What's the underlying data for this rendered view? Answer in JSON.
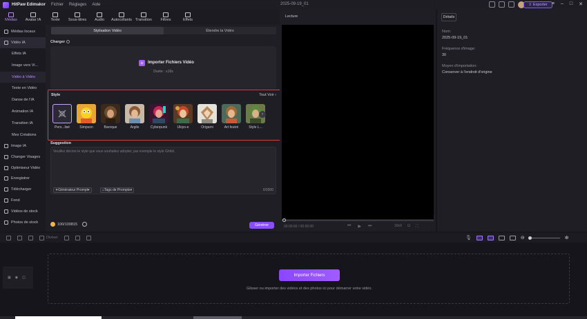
{
  "app": {
    "name": "HitPaw Edimakor",
    "menus": [
      "Fichier",
      "Réglages",
      "Aide"
    ],
    "project_date": "2025-09-19_01",
    "export_label": "Exporter"
  },
  "top_tabs": [
    "Médias",
    "Avatar IA",
    "Texte",
    "Sous-titres",
    "Audio",
    "Autocollants",
    "Transition",
    "Filtres",
    "Effets"
  ],
  "sidebar": {
    "items": [
      {
        "label": "Médias locaux",
        "level": "main"
      },
      {
        "label": "Vidéo IA",
        "level": "main",
        "active": true
      },
      {
        "label": "Effets IA",
        "level": "sub"
      },
      {
        "label": "Image vers Vi...",
        "level": "sub"
      },
      {
        "label": "Vidéo à Vidéo",
        "level": "sub",
        "selected": true
      },
      {
        "label": "Texte en Vidéo",
        "level": "sub"
      },
      {
        "label": "Danse de l'IA",
        "level": "sub"
      },
      {
        "label": "Animation IA",
        "level": "sub"
      },
      {
        "label": "Transition IA",
        "level": "sub"
      },
      {
        "label": "Mes Créations",
        "level": "sub"
      },
      {
        "label": "Image IA",
        "level": "main"
      },
      {
        "label": "Changer Visages",
        "level": "main"
      },
      {
        "label": "Optimiseur Vidéo",
        "level": "main"
      },
      {
        "label": "Enregistrer",
        "level": "main"
      },
      {
        "label": "Télécharger",
        "level": "main"
      },
      {
        "label": "Fond",
        "level": "main"
      },
      {
        "label": "Vidéos de stock",
        "level": "main"
      },
      {
        "label": "Photos de stock",
        "level": "main"
      }
    ]
  },
  "main": {
    "segments": [
      "Stylisation Vidéo",
      "Étendre la Vidéo"
    ],
    "charger_label": "Charger",
    "upload_title": "Importer Fichiers Vidéo",
    "upload_sub": "Durée : ≤16s",
    "style_label": "Style",
    "see_all": "Tout Voir",
    "styles": [
      "Pers...lisé",
      "Simpson",
      "Baroque",
      "Argile",
      "Cyberpunk",
      "Ukiyo-e",
      "Origami",
      "Art feutré",
      "Style L..."
    ],
    "suggestion_label": "Suggestion",
    "suggestion_placeholder": "Veuillez décrire le style que vous souhaitez adopter, par exemple le style Ghibli.",
    "prompt_generator": "Générateur Prompt",
    "prompt_tags": "Tags de Prompts",
    "char_counter": "0/2000",
    "credits": "100/100815",
    "generate_label": "Générer"
  },
  "preview": {
    "tab": "Lecture",
    "time": "00:00:00 / 00:00:00",
    "quality": "16x9"
  },
  "details": {
    "tab": "Détails",
    "fields": [
      {
        "key": "Nom:",
        "value": "2025-09-19_01"
      },
      {
        "key": "Fréquence d'image:",
        "value": "30"
      },
      {
        "key": "Moyen d'importation:",
        "value": "Conserver à l'endroit d'origine"
      }
    ]
  },
  "timeline": {
    "toolbar_label": "Diviser",
    "import_button": "Importer Fichiers",
    "drop_hint": "Glisser ou importer des vidéos et des photos ici pour démarrer votre vidéo."
  },
  "colors": {
    "accent": "#8b4dff",
    "highlight_border": "#e53a3a"
  }
}
